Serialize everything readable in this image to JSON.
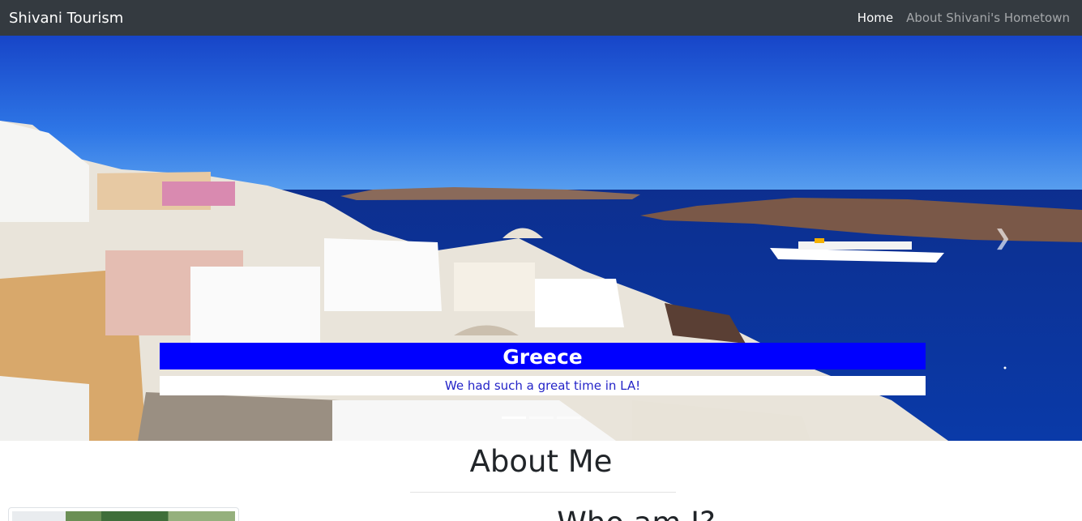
{
  "navbar": {
    "brand": "Shivani Tourism",
    "links": [
      {
        "label": "Home",
        "active": true
      },
      {
        "label": "About Shivani's Hometown",
        "active": false
      }
    ]
  },
  "carousel": {
    "slide_title": "Greece",
    "slide_caption": "We had such a great time in LA!",
    "next_icon": "chevron-right-icon",
    "indicators_count": 3,
    "active_indicator": 1,
    "colors": {
      "caption_title_bg": "#0000ff",
      "caption_text_color": "#2424c8"
    }
  },
  "about": {
    "title": "About Me",
    "sub_heading": "Who am I?"
  },
  "colors": {
    "navbar_bg": "#343a40"
  }
}
